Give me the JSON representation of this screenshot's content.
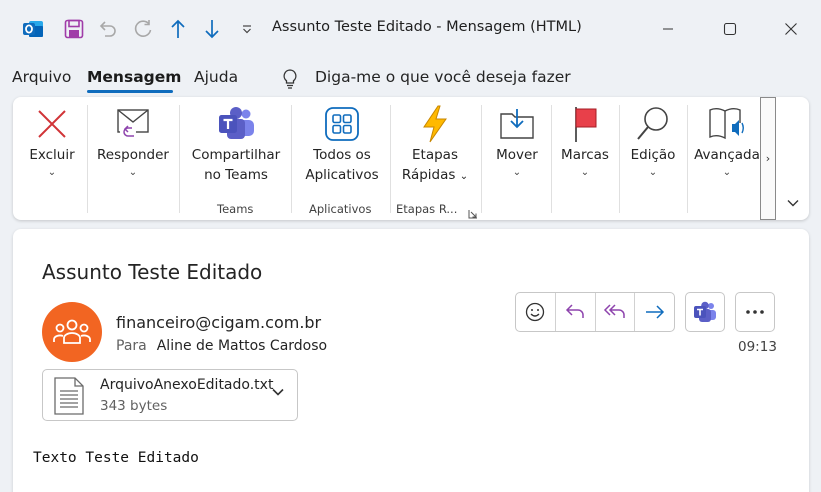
{
  "window": {
    "title": "Assunto Teste Editado  -  Mensagem (HTML)"
  },
  "quick_access": [
    "outlook-icon",
    "save-icon",
    "undo-icon",
    "redo-icon",
    "previous-item-icon",
    "next-item-icon",
    "customize-quick-access-icon"
  ],
  "menu": {
    "tabs": [
      "Arquivo",
      "Mensagem",
      "Ajuda"
    ],
    "active_tab": "Mensagem",
    "tell_me": "Diga-me o que você deseja fazer"
  },
  "ribbon": {
    "delete": {
      "label": "Excluir",
      "icon": "delete-x-icon"
    },
    "reply": {
      "label": "Responder",
      "icon": "reply-mail-icon"
    },
    "share_teams": {
      "label_line1": "Compartilhar",
      "label_line2": "no Teams",
      "icon": "teams-share-icon"
    },
    "all_apps": {
      "label_line1": "Todos os",
      "label_line2": "Aplicativos",
      "icon": "apps-grid-icon"
    },
    "quick_steps": {
      "label_line1": "Etapas",
      "label_line2": "Rápidas",
      "icon": "lightning-icon"
    },
    "move": {
      "label": "Mover",
      "icon": "move-folder-icon"
    },
    "tags": {
      "label": "Marcas",
      "icon": "flag-icon"
    },
    "editing": {
      "label": "Edição",
      "icon": "search-icon"
    },
    "advanced": {
      "label": "Avançada",
      "icon": "read-aloud-icon"
    },
    "groups": {
      "teams": "Teams",
      "apps": "Aplicativos",
      "quick_steps": "Etapas R..."
    },
    "scroll_glyph": "›"
  },
  "message": {
    "subject": "Assunto Teste Editado",
    "sender": "financeiro@cigam.com.br",
    "to_label": "Para",
    "to_name": "Aline de Mattos Cardoso",
    "time": "09:13",
    "avatar_color": "#f26522",
    "attachment": {
      "name": "ArquivoAnexoEditado.txt",
      "size": "343 bytes"
    },
    "body": "Texto Teste Editado"
  },
  "colors": {
    "accent_blue": "#0f6cbd",
    "teams_purple": "#5b5fc7",
    "delete_red": "#d13438",
    "flag_red": "#e8404a"
  }
}
